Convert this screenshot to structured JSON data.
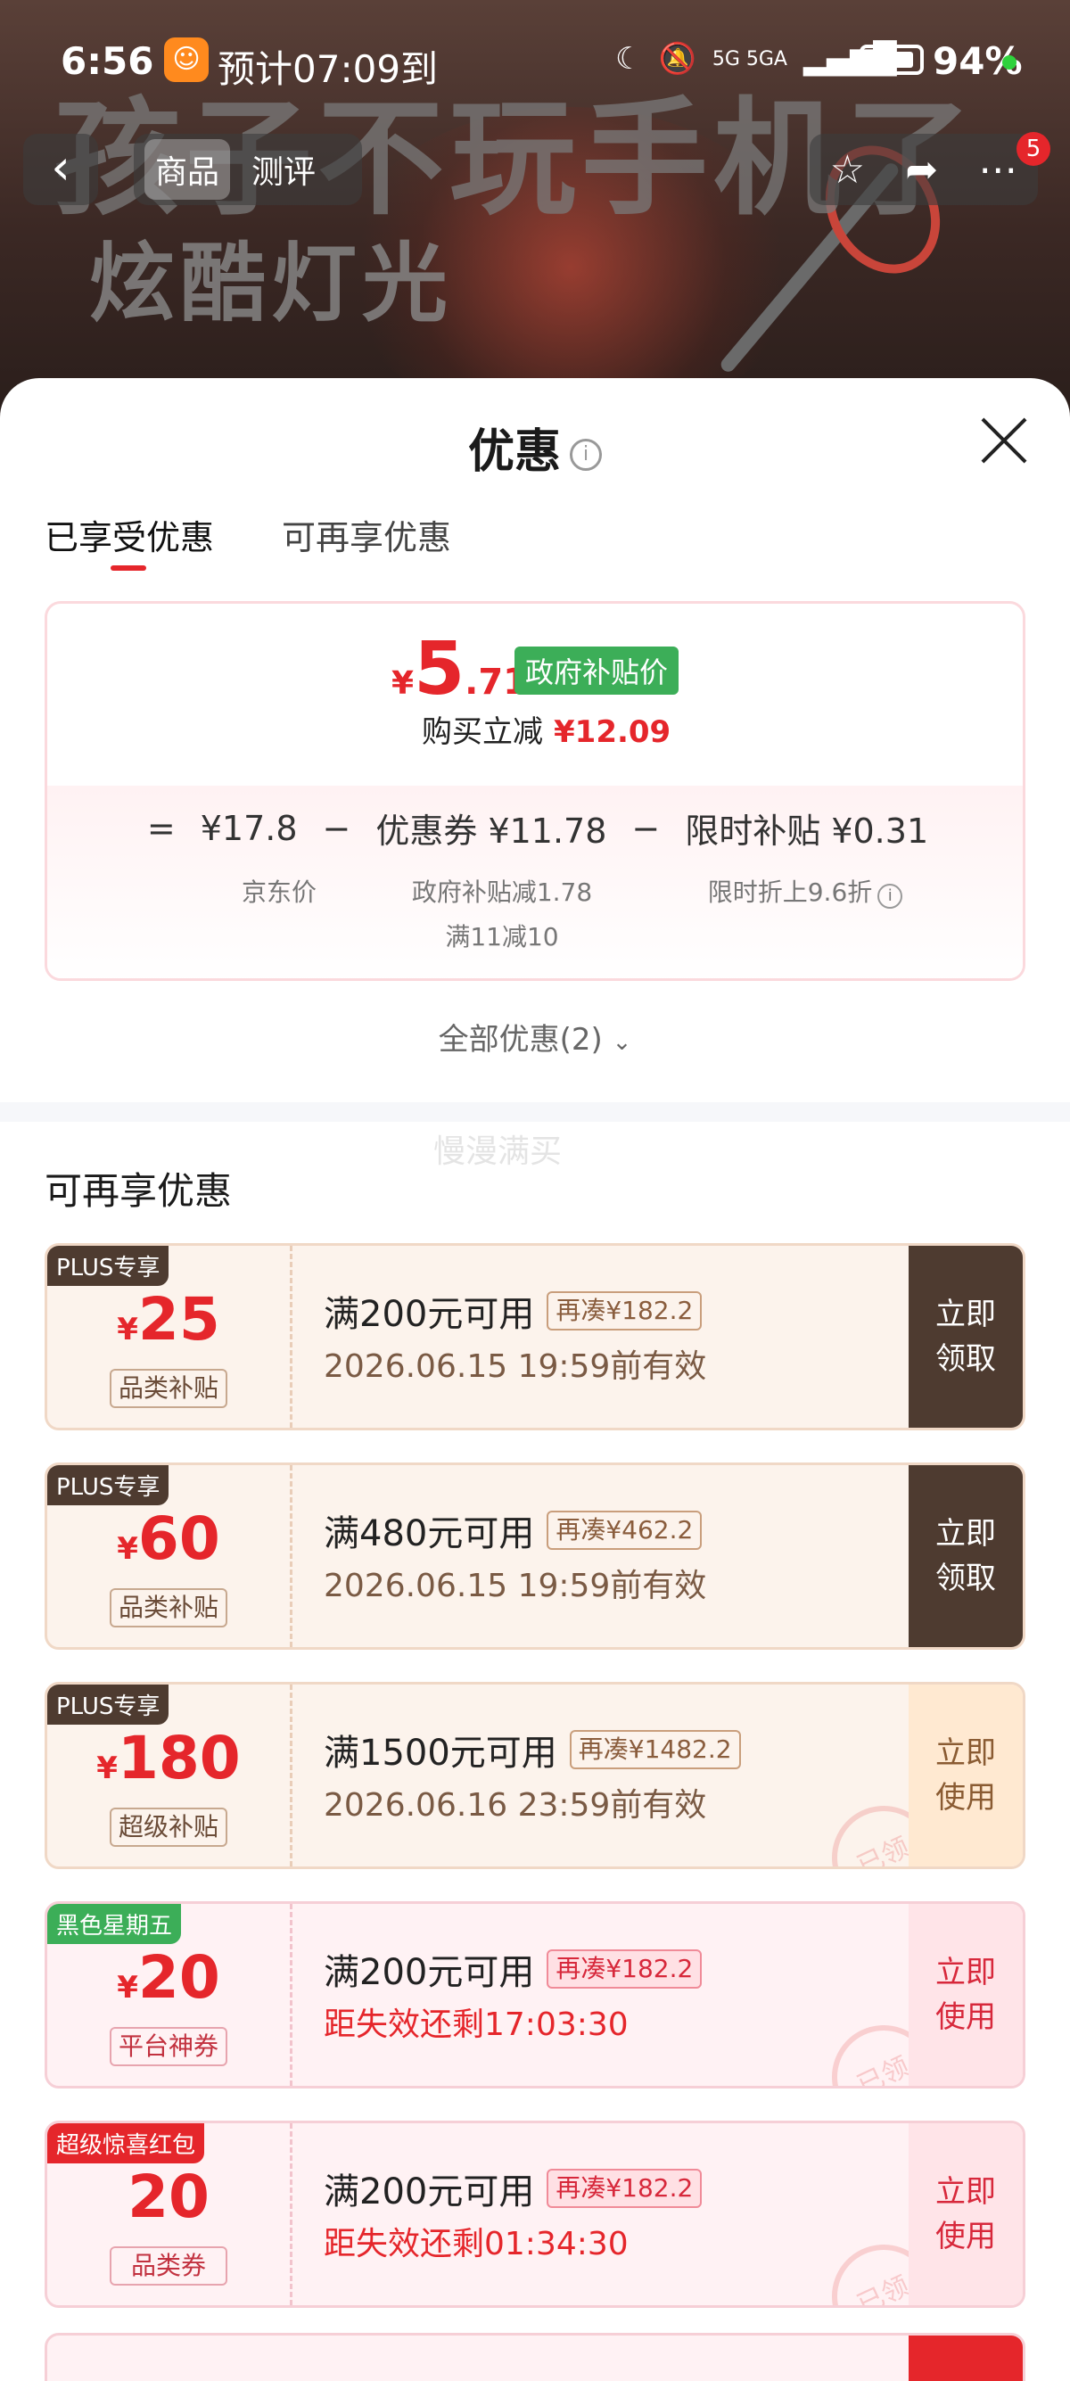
{
  "status_bar": {
    "time": "6:56",
    "eta": "预计07:09到",
    "network": "5G 5GA",
    "battery": "94%"
  },
  "background": {
    "headline": "孩子不玩手机了",
    "subline": "炫酷灯光"
  },
  "product_nav": {
    "tabs": [
      "商品",
      "测评"
    ],
    "active_tab": "商品",
    "badge_count": "5"
  },
  "sheet": {
    "title": "优惠",
    "tabs": [
      "已享受优惠",
      "可再享优惠"
    ],
    "active_tab": "已享受优惠",
    "calculation": {
      "currency": "¥",
      "final_price_int": "5",
      "final_price_dec": ".71",
      "price_tag": "政府补贴价",
      "reduce_label": "购买立减",
      "reduce_amount": "¥12.09",
      "formula": {
        "eq": "=",
        "jd_price": "¥17.8",
        "minus1": "−",
        "coupon_label": "优惠券 ¥11.78",
        "minus2": "−",
        "subsidy_label": "限时补贴 ¥0.31",
        "jd_price_note": "京东价",
        "coupon_note1": "政府补贴减1.78",
        "coupon_note2": "满11减10",
        "subsidy_note": "限时折上9.6折"
      }
    },
    "all_coupons_link": "全部优惠(2)",
    "ghost_text": "慢漫满买",
    "section_title": "可再享优惠",
    "coupons": [
      {
        "tag": "PLUS专享",
        "currency": "¥",
        "amount": "25",
        "kind": "品类补贴",
        "condition": "满200元可用",
        "gap": "再凑¥182.2",
        "expiry": "2026.06.15 19:59前有效",
        "button": "立即\n领取"
      },
      {
        "tag": "PLUS专享",
        "currency": "¥",
        "amount": "60",
        "kind": "品类补贴",
        "condition": "满480元可用",
        "gap": "再凑¥462.2",
        "expiry": "2026.06.15 19:59前有效",
        "button": "立即\n领取"
      },
      {
        "tag": "PLUS专享",
        "currency": "¥",
        "amount": "180",
        "kind": "超级补贴",
        "condition": "满1500元可用",
        "gap": "再凑¥1482.2",
        "expiry": "2026.06.16 23:59前有效",
        "button": "立即\n使用",
        "stamp": "已领"
      },
      {
        "tag": "黑色星期五",
        "currency": "¥",
        "amount": "20",
        "kind": "平台神券",
        "condition": "满200元可用",
        "gap": "再凑¥182.2",
        "expiry": "距失效还剩17:03:30",
        "button": "立即\n使用",
        "stamp": "已领"
      },
      {
        "tag": "超级惊喜红包",
        "currency": "",
        "amount": "20",
        "kind": "品类券",
        "condition": "满200元可用",
        "gap": "再凑¥182.2",
        "expiry": "距失效还剩01:34:30",
        "button": "立即\n使用",
        "stamp": "已领"
      }
    ]
  }
}
